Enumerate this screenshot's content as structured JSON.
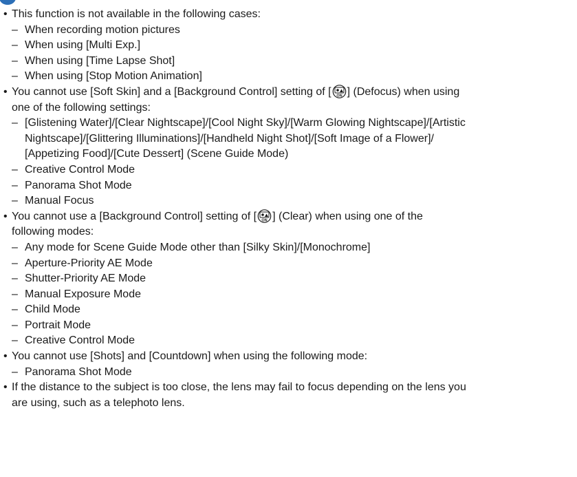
{
  "bullets": [
    {
      "text": "This function is not available in the following cases:",
      "items": [
        "When recording motion pictures",
        "When using [Multi Exp.]",
        "When using [Time Lapse Shot]",
        "When using [Stop Motion Animation]"
      ]
    },
    {
      "text_line1_before": "You cannot use [Soft Skin] and a [Background Control] setting of [",
      "text_line1_after": "] (Defocus) when using",
      "text_line2": "one of the following settings:",
      "icon_name": "background-defocus-icon",
      "items_multi_line1": "[Glistening Water]/[Clear Nightscape]/[Cool Night Sky]/[Warm Glowing Nightscape]/[Artistic",
      "items_multi_line2": "Nightscape]/[Glittering Illuminations]/[Handheld Night Shot]/[Soft Image of a Flower]/",
      "items_multi_line3": "[Appetizing Food]/[Cute Dessert] (Scene Guide Mode)",
      "items": [
        "Creative Control Mode",
        "Panorama Shot Mode",
        "Manual Focus"
      ]
    },
    {
      "text_line1_before": "You cannot use a [Background Control] setting of [",
      "text_line1_after": "] (Clear) when using one of the",
      "text_line2": "following modes:",
      "icon_name": "background-clear-icon",
      "items": [
        "Any mode for Scene Guide Mode other than [Silky Skin]/[Monochrome]",
        "Aperture-Priority AE Mode",
        "Shutter-Priority AE Mode",
        "Manual Exposure Mode",
        "Child Mode",
        "Portrait Mode",
        "Creative Control Mode"
      ]
    },
    {
      "text": "You cannot use [Shots] and [Countdown] when using the following mode:",
      "items": [
        "Panorama Shot Mode"
      ]
    },
    {
      "text_line1": "If the distance to the subject is too close, the lens may fail to focus depending on the lens you",
      "text_line2": "are using, such as a telephoto lens."
    }
  ],
  "colors": {
    "note_icon": "#2c6fb7",
    "text": "#1a1a1a"
  }
}
